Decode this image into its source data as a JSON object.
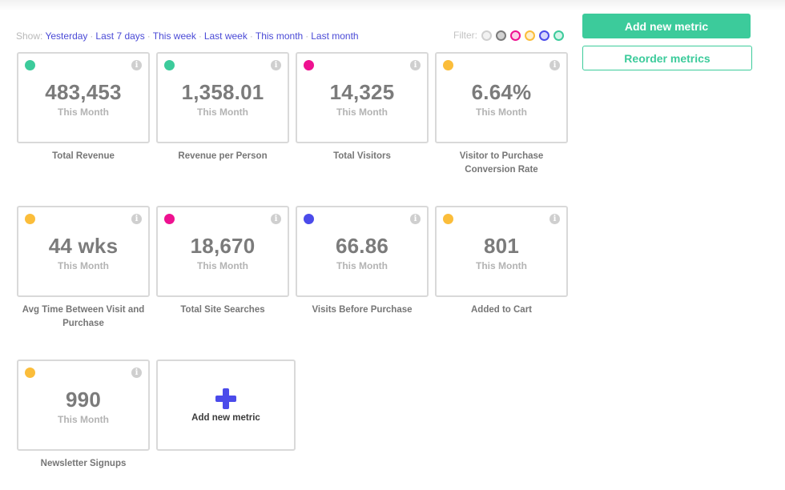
{
  "show": {
    "label": "Show:",
    "options": [
      "Yesterday",
      "Last 7 days",
      "This week",
      "Last week",
      "This month",
      "Last month"
    ],
    "separator": "·"
  },
  "filter": {
    "label": "Filter:",
    "colors": [
      {
        "name": "gray-light",
        "border": "#cfcfcf",
        "fill": "#f2f2f2"
      },
      {
        "name": "gray-dark",
        "border": "#7b7b7b",
        "fill": "#d2d2d2"
      },
      {
        "name": "pink",
        "border": "#ee1190",
        "fill": "#fbd1e8"
      },
      {
        "name": "yellow",
        "border": "#fbbd3a",
        "fill": "#fff0cc"
      },
      {
        "name": "blue",
        "border": "#4b4bea",
        "fill": "#d6d6fb"
      },
      {
        "name": "green",
        "border": "#3ccb9b",
        "fill": "#d3f4e8"
      }
    ]
  },
  "actions": {
    "add_label": "Add new metric",
    "reorder_label": "Reorder metrics"
  },
  "colors": {
    "accent": "#3ccb9b",
    "green": "#3ccb9b",
    "pink": "#ee1190",
    "yellow": "#fbbd3a",
    "blue": "#4b4bea"
  },
  "metrics": [
    {
      "value": "483,453",
      "period": "This Month",
      "title": "Total Revenue",
      "color": "#3ccb9b",
      "info_icon": "info-icon"
    },
    {
      "value": "1,358.01",
      "period": "This Month",
      "title": "Revenue per Person",
      "color": "#3ccb9b",
      "info_icon": "info-icon"
    },
    {
      "value": "14,325",
      "period": "This Month",
      "title": "Total Visitors",
      "color": "#ee1190",
      "info_icon": "info-icon"
    },
    {
      "value": "6.64%",
      "period": "This Month",
      "title": "Visitor to Purchase Conversion Rate",
      "color": "#fbbd3a",
      "info_icon": "info-icon"
    },
    {
      "value": "44 wks",
      "period": "This Month",
      "title": "Avg Time Between Visit and Purchase",
      "color": "#fbbd3a",
      "info_icon": "info-icon"
    },
    {
      "value": "18,670",
      "period": "This Month",
      "title": "Total Site Searches",
      "color": "#ee1190",
      "info_icon": "info-icon"
    },
    {
      "value": "66.86",
      "period": "This Month",
      "title": "Visits Before Purchase",
      "color": "#4b4bea",
      "info_icon": "info-icon"
    },
    {
      "value": "801",
      "period": "This Month",
      "title": "Added to Cart",
      "color": "#fbbd3a",
      "info_icon": "info-icon"
    },
    {
      "value": "990",
      "period": "This Month",
      "title": "Newsletter Signups",
      "color": "#fbbd3a",
      "info_icon": "info-icon"
    }
  ],
  "add_card": {
    "label": "Add new metric",
    "icon": "plus-icon"
  },
  "info_glyph": "i"
}
